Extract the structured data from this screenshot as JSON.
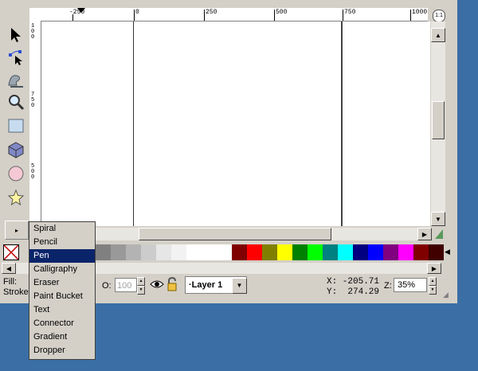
{
  "ruler": {
    "top_labels": [
      "-250",
      "0",
      "250",
      "500",
      "750",
      "1000"
    ],
    "left_labels": [
      "100",
      "750",
      "500"
    ]
  },
  "zoom_fit_label": "1:1",
  "tools": [
    {
      "name": "selector-arrow-icon"
    },
    {
      "name": "node-editor-icon"
    },
    {
      "name": "tweak-tool-icon"
    },
    {
      "name": "zoom-tool-icon"
    },
    {
      "name": "rectangle-tool-icon"
    },
    {
      "name": "3d-box-tool-icon"
    },
    {
      "name": "ellipse-tool-icon"
    },
    {
      "name": "star-tool-icon"
    }
  ],
  "flyout_arrow": "▸",
  "menu": {
    "items": [
      "Spiral",
      "Pencil",
      "Pen",
      "Calligraphy",
      "Eraser",
      "Paint Bucket",
      "Text",
      "Connector",
      "Gradient",
      "Dropper"
    ],
    "selected": "Pen"
  },
  "palette": {
    "colors": [
      "#808080",
      "#999999",
      "#b3b3b3",
      "#cccccc",
      "#e6e6e6",
      "#f2f2f2",
      "#ffffff",
      "#ffffff",
      "#ffffff",
      "#800000",
      "#ff0000",
      "#808000",
      "#ffff00",
      "#008000",
      "#00ff00",
      "#008080",
      "#00ffff",
      "#000080",
      "#0000ff",
      "#800080",
      "#ff00ff",
      "#800000",
      "#400000"
    ]
  },
  "status": {
    "fill_label": "Fill:",
    "stroke_label": "Stroke",
    "opacity_label": "O:",
    "opacity_value": "100",
    "layer_name": "·Layer 1",
    "x_readout": "X: -205.71",
    "y_readout": "Y:  274.29",
    "zoom_label": "Z:",
    "zoom_value": "35%"
  },
  "colors": {
    "desktop": "#3a6ea5",
    "chrome": "#d4d0c8",
    "menu_selected": "#0a246a"
  }
}
